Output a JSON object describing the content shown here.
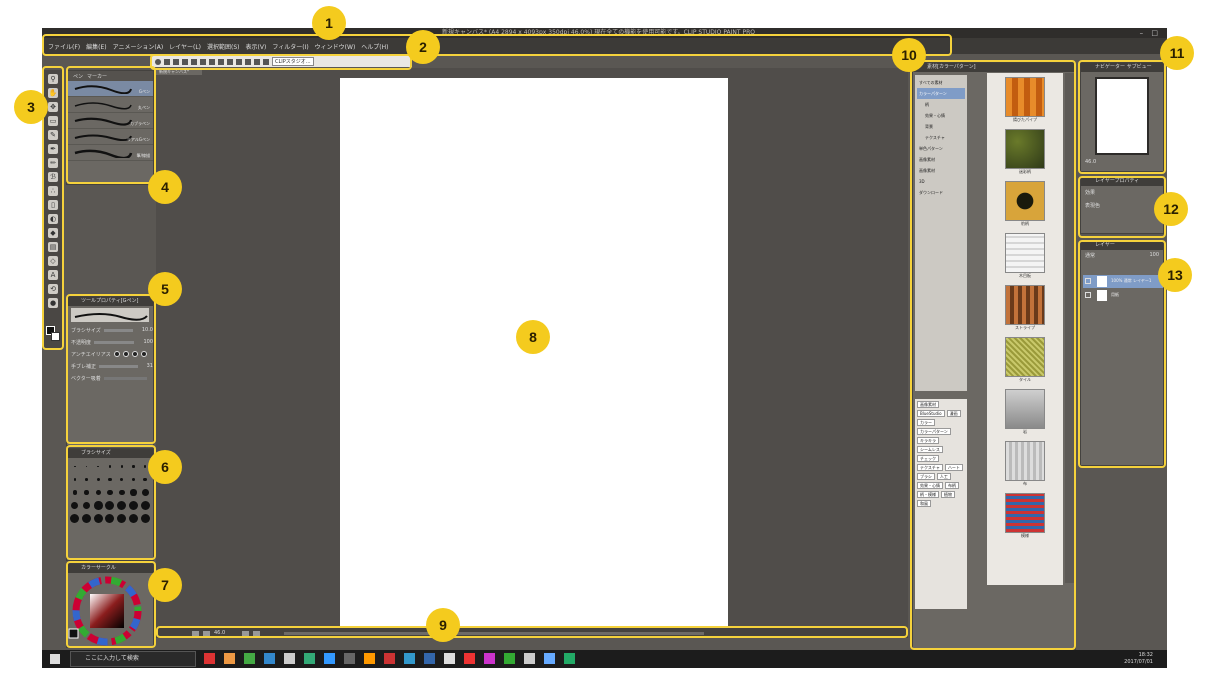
{
  "window": {
    "title": "新規キャンバス* (A4 2894 x 4093px 350dpi 46.0%) 現在全ての機能を使用可能です。CLIP STUDIO PAINT PRO",
    "controls": "– □"
  },
  "menu": [
    "ファイル(F)",
    "編集(E)",
    "アニメーション(A)",
    "レイヤー(L)",
    "選択範囲(S)",
    "表示(V)",
    "フィルター(I)",
    "ウィンドウ(W)",
    "ヘルプ(H)"
  ],
  "command_bar": {
    "clip_button": "CLIPスタジオ..."
  },
  "tools": [
    "zoom-icon",
    "hand-icon",
    "rotate-icon",
    "move-icon",
    "select-icon",
    "lasso-icon",
    "eyedropper-icon",
    "pen-icon",
    "pencil-icon",
    "brush-icon",
    "airbrush-icon",
    "eraser-icon",
    "blend-icon",
    "fill-icon",
    "gradient-icon",
    "figure-icon",
    "text-icon",
    "correct-icon"
  ],
  "subtool": {
    "tabs": [
      "ペン",
      "マーカー"
    ],
    "brushes": [
      "Gペン",
      "丸ペン",
      "カブラペン",
      "リアルGペン",
      "筆/線描"
    ]
  },
  "tool_property": {
    "title": "ツールプロパティ[Gペン]",
    "rows": [
      "ブラシサイズ",
      "不透明度",
      "アンチエイリアス",
      "手ブレ補正",
      "ベクター吸着"
    ],
    "values": [
      "10.0",
      "100",
      "",
      "31",
      ""
    ]
  },
  "brush_size": {
    "title": "ブラシサイズ",
    "sizes": [
      "0.7",
      "1",
      "1.5",
      "2",
      "2.5",
      "3",
      "4",
      "5",
      "6",
      "7",
      "8",
      "10",
      "12",
      "15",
      "17",
      "20",
      "25",
      "30",
      "40",
      "50",
      "60",
      "70",
      "80",
      "100",
      "120",
      "150",
      "170",
      "200",
      "250",
      "300",
      "400",
      "500",
      "600",
      "700",
      "800"
    ]
  },
  "color": {
    "main": "#8b1d1d",
    "foreground": "#111111",
    "background": "#ffffff",
    "tabs": "カラーサークル"
  },
  "canvas": {
    "tab": "新規キャンバス*"
  },
  "navigation": {
    "zoom": "46.0"
  },
  "material": {
    "title": "素材[カラーパターン]",
    "tree": [
      "すべての素材",
      "カラーパターン",
      "柄",
      "効果・心情",
      "背景",
      "テクスチャ",
      "単色パターン",
      "画像素材",
      "画像素材",
      "3D",
      "ダウンロード"
    ],
    "tag_header": "検索用タグ",
    "tags": [
      "画像素材",
      "BlueStudio",
      "漫画",
      "カラー",
      "カラーパターン",
      "キラキラ",
      "シームレス",
      "チェック",
      "テクスチャ",
      "ハート",
      "ブラシ",
      "人工",
      "効果・心情",
      "布柄",
      "柄・模様",
      "植物",
      "和風"
    ],
    "thumbs": [
      "錆びたパイプ",
      "迷彩柄",
      "豹柄",
      "木目板",
      "ストライプ",
      "タイル",
      "岩",
      "布",
      "模様"
    ]
  },
  "navigator": {
    "tabs": [
      "ナビゲーター",
      "サブビュー"
    ],
    "zoom": "46.0"
  },
  "layer_property": {
    "title": "レイヤープロパティ",
    "label": "効果",
    "color": "表現色"
  },
  "layers": {
    "title": "レイヤー",
    "blend": "通常",
    "opacity": "100",
    "items": [
      "100% 通常 レイヤー1",
      "用紙"
    ]
  },
  "taskbar": {
    "search": "ここに入力して検索",
    "time": "18:32",
    "date": "2017/07/01"
  },
  "callouts": [
    "1",
    "2",
    "3",
    "4",
    "5",
    "6",
    "7",
    "8",
    "9",
    "10",
    "11",
    "12",
    "13"
  ],
  "accent": "#f4cb1e"
}
